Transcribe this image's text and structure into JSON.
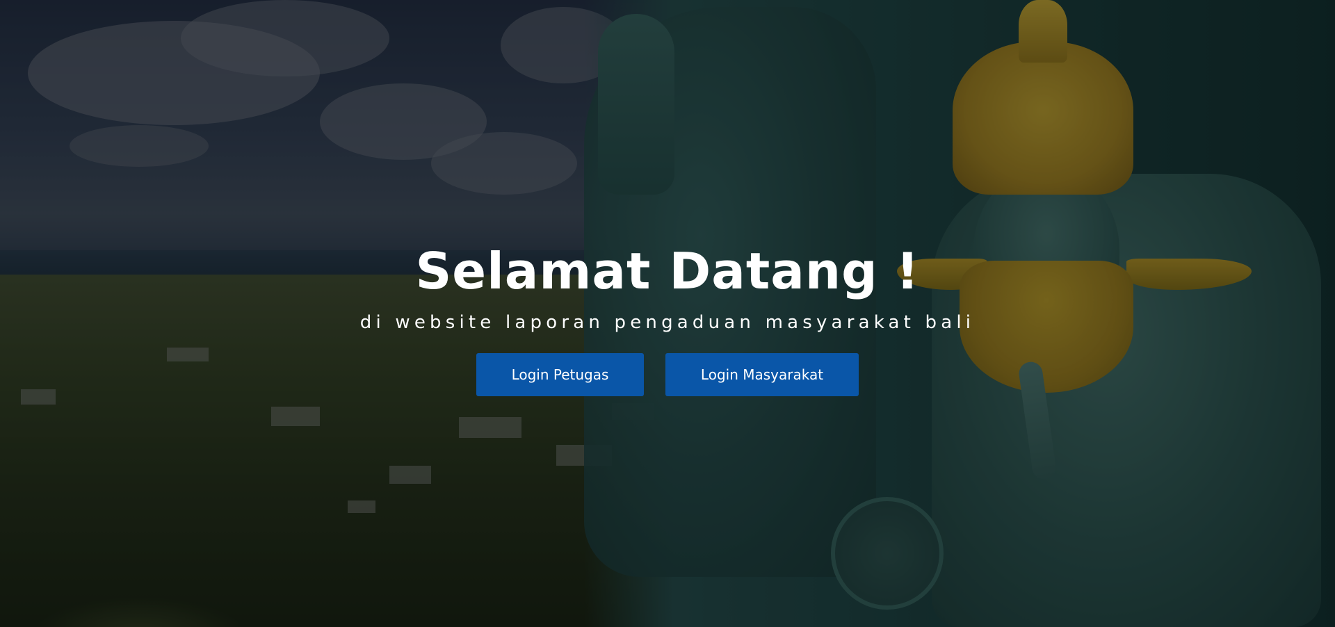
{
  "hero": {
    "title": "Selamat Datang !",
    "subtitle": "di website laporan pengaduan masyarakat bali"
  },
  "buttons": {
    "login_petugas": "Login Petugas",
    "login_masyarakat": "Login Masyarakat"
  },
  "colors": {
    "button_bg": "#0a56a8",
    "text": "#ffffff",
    "overlay": "rgba(0,0,0,0.45)"
  }
}
